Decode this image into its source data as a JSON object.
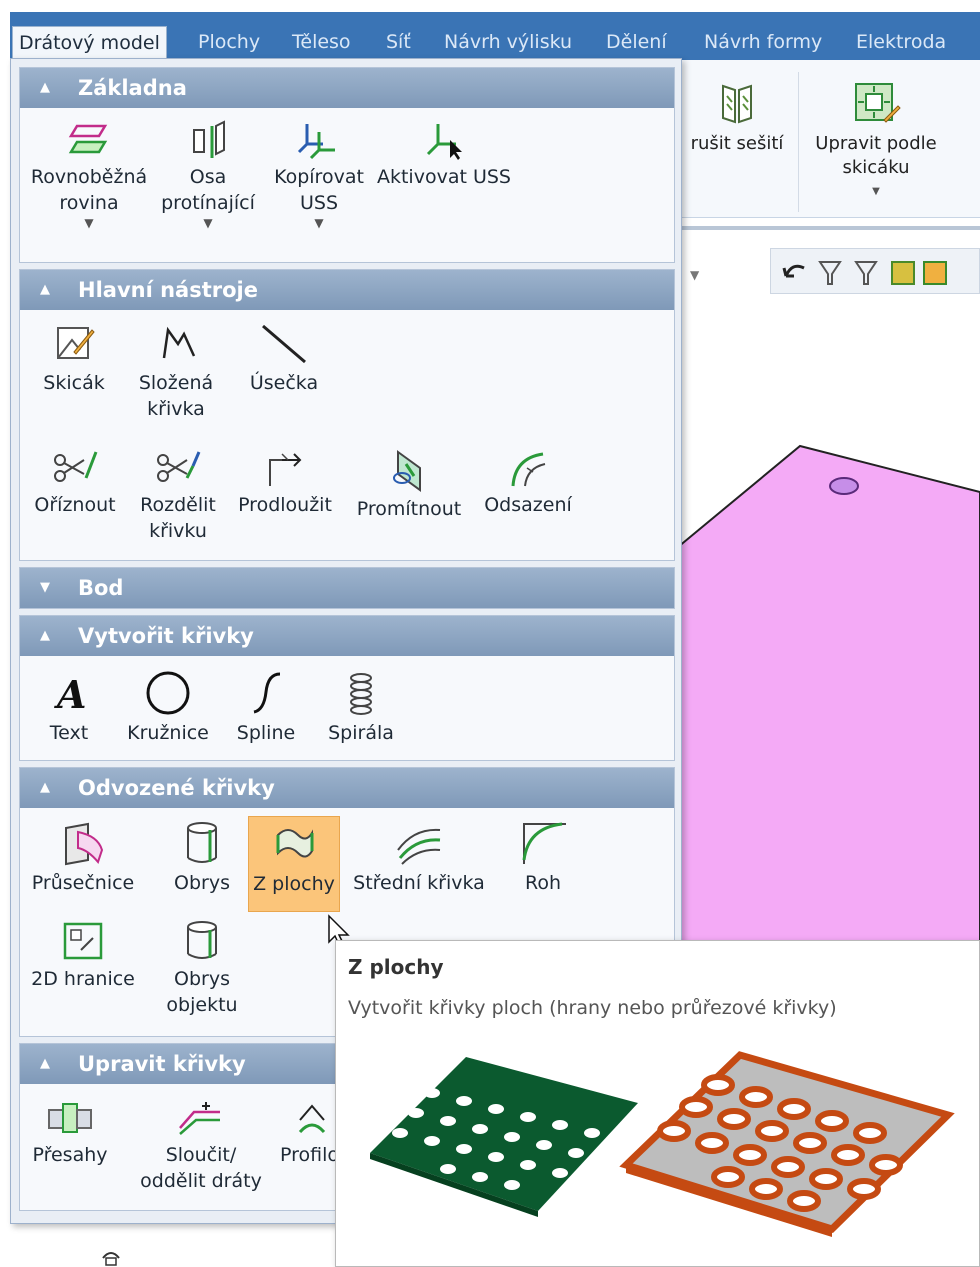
{
  "tabs": [
    {
      "label": "Drátový model",
      "active": true
    },
    {
      "label": "Plochy"
    },
    {
      "label": "Těleso"
    },
    {
      "label": "Síť"
    },
    {
      "label": "Návrh výlisku"
    },
    {
      "label": "Dělení"
    },
    {
      "label": "Návrh formy"
    },
    {
      "label": "Elektroda"
    }
  ],
  "ribbon": {
    "cancel_stitch_label": "rušit sešití",
    "edit_by_sketch_label_1": "Upravit podle",
    "edit_by_sketch_label_2": "skicáku"
  },
  "groups": {
    "zakladna": {
      "title": "Základna",
      "items": [
        {
          "line1": "Rovnoběžná",
          "line2": "rovina",
          "dropdown": true
        },
        {
          "line1": "Osa",
          "line2": "protínající",
          "dropdown": true
        },
        {
          "line1": "Kopírovat",
          "line2": "USS",
          "dropdown": true
        },
        {
          "line1": "Aktivovat USS",
          "line2": ""
        }
      ]
    },
    "hlavni": {
      "title": "Hlavní nástroje",
      "items": [
        {
          "line1": "Skicák",
          "line2": ""
        },
        {
          "line1": "Složená",
          "line2": "křivka"
        },
        {
          "line1": "Úsečka",
          "line2": ""
        },
        {
          "line1": "Oříznout",
          "line2": ""
        },
        {
          "line1": "Rozdělit",
          "line2": "křivku"
        },
        {
          "line1": "Prodloužit",
          "line2": ""
        },
        {
          "line1": "Promítnout",
          "line2": ""
        },
        {
          "line1": "Odsazení",
          "line2": ""
        }
      ]
    },
    "bod": {
      "title": "Bod"
    },
    "vytvorit": {
      "title": "Vytvořit křivky",
      "items": [
        {
          "line1": "Text"
        },
        {
          "line1": "Kružnice"
        },
        {
          "line1": "Spline"
        },
        {
          "line1": "Spirála"
        }
      ]
    },
    "odvozene": {
      "title": "Odvozené křivky",
      "items": [
        {
          "line1": "Průsečnice",
          "line2": ""
        },
        {
          "line1": "Obrys",
          "line2": ""
        },
        {
          "line1": "Z plochy",
          "line2": ""
        },
        {
          "line1": "Střední křivka",
          "line2": ""
        },
        {
          "line1": "Roh",
          "line2": ""
        },
        {
          "line1": "2D hranice",
          "line2": ""
        },
        {
          "line1": "Obrys",
          "line2": "objektu"
        }
      ]
    },
    "upravit": {
      "title": "Upravit křivky",
      "items": [
        {
          "line1": "Přesahy",
          "line2": ""
        },
        {
          "line1": "Sloučit/",
          "line2": "oddělit dráty"
        },
        {
          "line1": "Profilo",
          "line2": ""
        }
      ]
    }
  },
  "tooltip": {
    "title": "Z plochy",
    "description": "Vytvořit křivky ploch (hrany nebo průřezové křivky)"
  },
  "colors": {
    "tab_bar": "#3a74b5",
    "group_header": "#8aa3c1",
    "highlight": "#fbc57a",
    "model_fill": "#f4aaf6",
    "plate_green": "#0b5a2f",
    "plate_orange": "#c54a12"
  }
}
